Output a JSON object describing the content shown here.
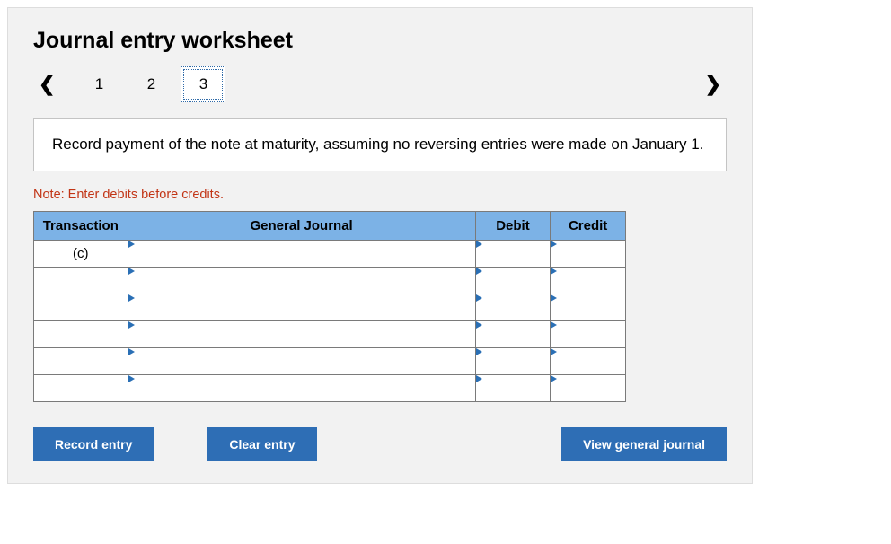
{
  "title": "Journal entry worksheet",
  "pager": {
    "pages": [
      "1",
      "2",
      "3"
    ],
    "active_index": 2
  },
  "instruction": "Record payment of the note at maturity, assuming no reversing entries were made on January 1.",
  "note": "Note: Enter debits before credits.",
  "table": {
    "headers": {
      "transaction": "Transaction",
      "general_journal": "General Journal",
      "debit": "Debit",
      "credit": "Credit"
    },
    "rows": [
      {
        "transaction": "(c)",
        "general_journal": "",
        "debit": "",
        "credit": ""
      },
      {
        "transaction": "",
        "general_journal": "",
        "debit": "",
        "credit": ""
      },
      {
        "transaction": "",
        "general_journal": "",
        "debit": "",
        "credit": ""
      },
      {
        "transaction": "",
        "general_journal": "",
        "debit": "",
        "credit": ""
      },
      {
        "transaction": "",
        "general_journal": "",
        "debit": "",
        "credit": ""
      },
      {
        "transaction": "",
        "general_journal": "",
        "debit": "",
        "credit": ""
      }
    ]
  },
  "buttons": {
    "record": "Record entry",
    "clear": "Clear entry",
    "view": "View general journal"
  }
}
